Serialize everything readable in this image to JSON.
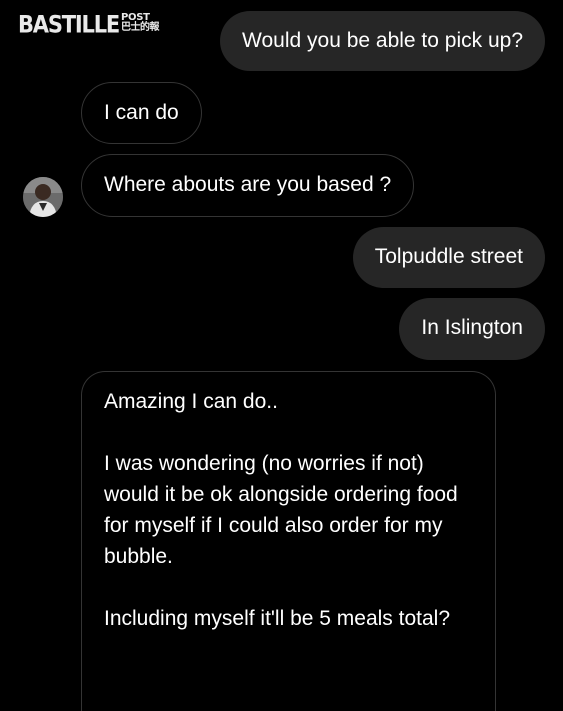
{
  "watermark": {
    "main": "BASTILLE",
    "post": "POST",
    "cjk": "巴士的報"
  },
  "messages": [
    {
      "id": "m1",
      "direction": "outgoing",
      "text": "Would you be able to pick up?"
    },
    {
      "id": "m2",
      "direction": "incoming",
      "text": "I can do"
    },
    {
      "id": "m3",
      "direction": "incoming",
      "text": "Where abouts are you based ?"
    },
    {
      "id": "m4",
      "direction": "outgoing",
      "text": "Tolpuddle street"
    },
    {
      "id": "m5",
      "direction": "outgoing",
      "text": "In Islington"
    },
    {
      "id": "m6",
      "direction": "incoming",
      "paragraphs": [
        "Amazing I can do..",
        "I was wondering (no worries if not) would it be ok alongside ordering food for myself if I could also order for my bubble.",
        "Including myself it'll be 5 meals total?"
      ]
    }
  ],
  "colors": {
    "background": "#000000",
    "outgoing_bubble": "#262626",
    "incoming_border": "#343434",
    "text": "#ffffff"
  }
}
